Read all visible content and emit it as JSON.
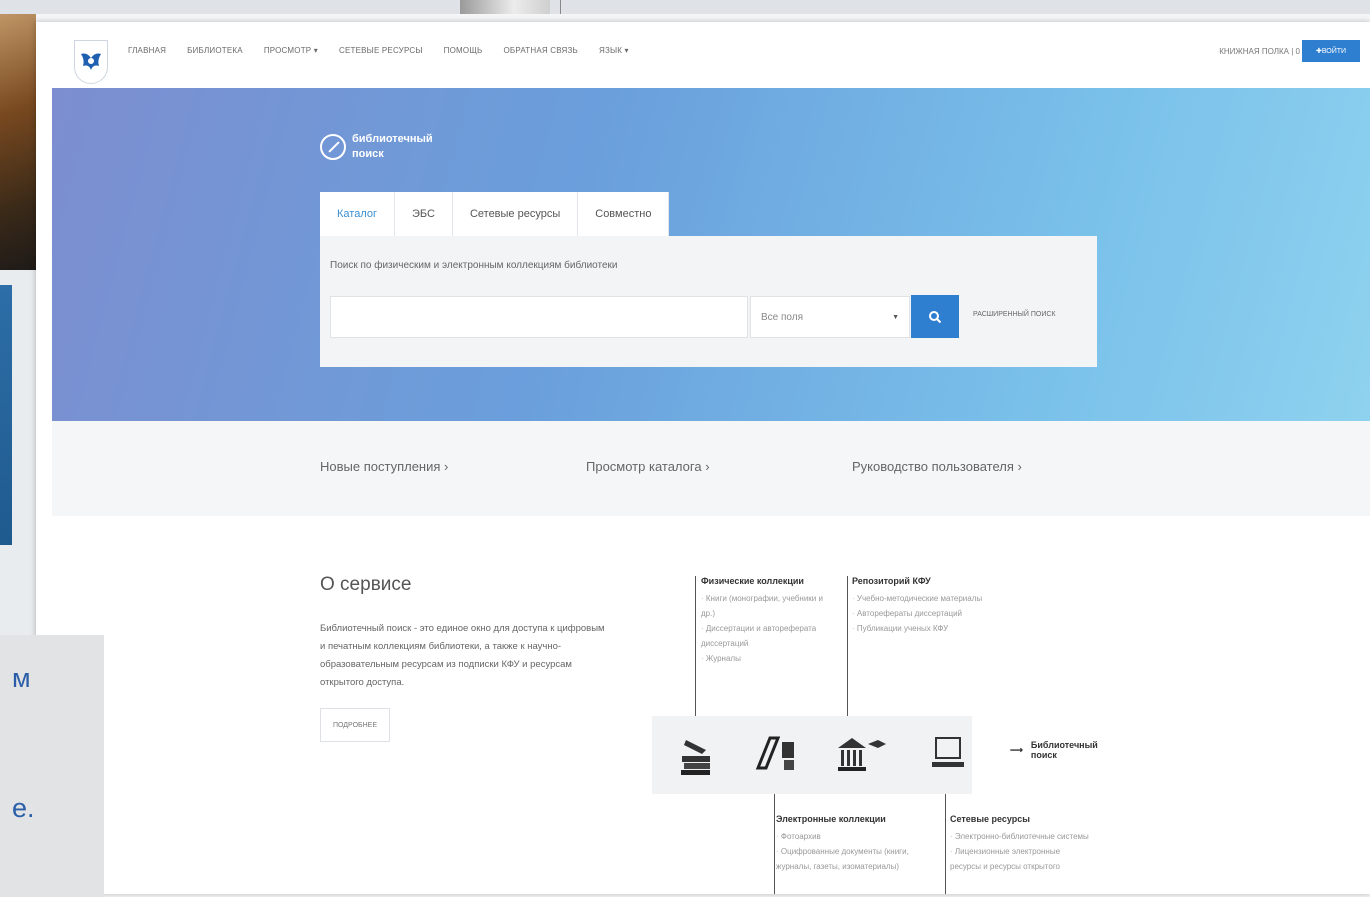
{
  "nav": {
    "items": [
      "ГЛАВНАЯ",
      "БИБЛИОТЕКА",
      "ПРОСМОТР ▾",
      "СЕТЕВЫЕ РЕСУРСЫ",
      "ПОМОЩЬ",
      "ОБРАТНАЯ СВЯЗЬ",
      "ЯЗЫК ▾"
    ],
    "shelf": "КНИЖНАЯ ПОЛКА | 0",
    "login": "✚ВОЙТИ"
  },
  "hero": {
    "title_line1": "библиотечный",
    "title_line2": "поиск",
    "tabs": [
      "Каталог",
      "ЭБС",
      "Сетевые ресурсы",
      "Совместно"
    ],
    "description": "Поиск по физическим и электронным коллекциям библиотеки",
    "search_placeholder": "",
    "field_select": "Все поля",
    "advanced": "РАСШИРЕННЫЙ ПОИСК"
  },
  "quick_links": [
    "Новые поступления  ›",
    "Просмотр каталога  ›",
    "Руководство пользователя  ›"
  ],
  "about": {
    "title": "О сервисе",
    "text": "Библиотечный поиск - это единое окно для доступа к цифровым и печатным коллекциям библиотеки, а также к научно-образовательным ресурсам из подписки КФУ и ресурсам открытого доступа.",
    "more": "ПОДРОБНЕЕ"
  },
  "diagram": {
    "physical": {
      "title": "Физические коллекции",
      "items": [
        "Книги (монографии, учебники и др.)",
        "Диссертации и автореферата диссертаций",
        "Журналы"
      ]
    },
    "repository": {
      "title": "Репозиторий КФУ",
      "items": [
        "Учебно-методические материалы",
        "Авторефераты диссертаций",
        "Публикации ученых КФУ"
      ]
    },
    "electronic": {
      "title": "Электронные коллекции",
      "items": [
        "Фотоархив",
        "Оцифрованные документы (книги, журналы, газеты, изоматериалы)"
      ]
    },
    "network": {
      "title": "Сетевые ресурсы",
      "items": [
        "Электронно-библиотечные системы",
        "Лицензионные электронные ресурсы и ресурсы открытого"
      ]
    },
    "result_line1": "Библиотечный",
    "result_line2": "поиск"
  },
  "overlay": {
    "line1": "м",
    "line2": "е."
  }
}
